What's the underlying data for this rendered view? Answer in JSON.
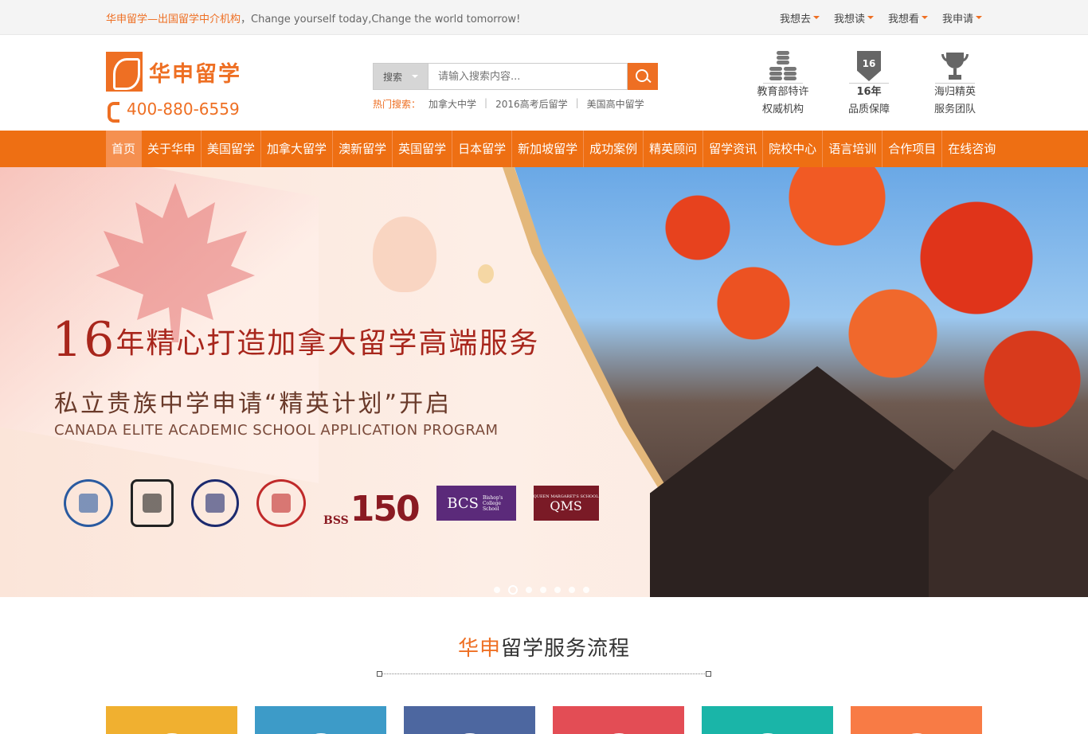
{
  "topbar": {
    "slogan_accent": "华申留学—出国留学中介机构",
    "slogan_rest": "，Change yourself today,Change the world tomorrow!",
    "menu": [
      "我想去",
      "我想读",
      "我想看",
      "我申请"
    ]
  },
  "header": {
    "logo_text": "华申留学",
    "phone": "400-880-6559",
    "search": {
      "select_label": "搜索",
      "placeholder": "请输入搜索内容..."
    },
    "hot": {
      "label": "热门搜索：",
      "items": [
        "加拿大中学",
        "2016高考后留学",
        "美国高中留学"
      ]
    },
    "badges": [
      {
        "icon": "coins-icon",
        "line1": "教育部特许",
        "line2": "权威机构"
      },
      {
        "icon": "shield-16-icon",
        "icon_text": "16",
        "line1": "16年",
        "line2": "品质保障"
      },
      {
        "icon": "trophy-icon",
        "line1": "海归精英",
        "line2": "服务团队"
      }
    ]
  },
  "nav": {
    "items": [
      "首页",
      "关于华申",
      "美国留学",
      "加拿大留学",
      "澳新留学",
      "英国留学",
      "日本留学",
      "新加坡留学",
      "成功案例",
      "精英顾问",
      "留学资讯",
      "院校中心",
      "语言培训",
      "合作项目",
      "在线咨询"
    ],
    "active_index": 0
  },
  "banner": {
    "title_number": "16",
    "title_rest": "年精心打造加拿大留学高端服务",
    "subtitle": "私立贵族中学申请“精英计划”开启",
    "english": "CANADA ELITE ACADEMIC SCHOOL APPLICATION PROGRAM",
    "logos": {
      "bss_small": "BSS",
      "bss_big": "150",
      "bcs": "BCS",
      "bcs_small": "Bishop's College School",
      "qms_small": "QUEEN MARGARET'S SCHOOL",
      "qms": "QMS"
    },
    "slide_count": 7,
    "active_slide": 1
  },
  "section": {
    "title_accent": "华申",
    "title_rest": "留学服务流程"
  },
  "steps": {
    "colors": [
      "#f0b030",
      "#3d9bc8",
      "#4d67a0",
      "#e34d55",
      "#1ab5a8",
      "#f87b45"
    ]
  },
  "colors": {
    "brand": "#ee6f23",
    "nav": "#ee6f13"
  }
}
